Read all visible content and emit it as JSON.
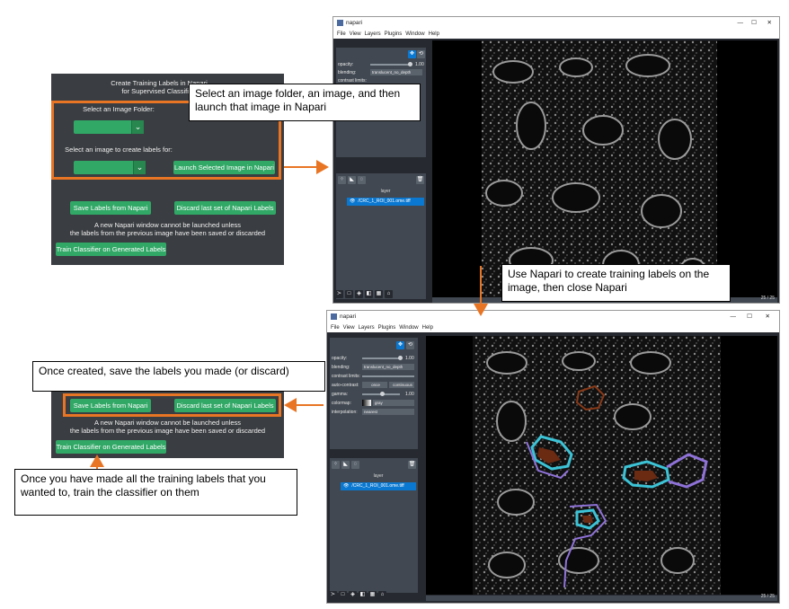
{
  "plugin_top": {
    "title_line1": "Create Training Labels in Napari",
    "title_line2": "for Supervised Classifier:",
    "select_folder_label": "Select an Image Folder:",
    "select_image_label": "Select an image to create labels for:",
    "launch_button": "Launch Selected Image in Napari",
    "save_button": "Save Labels from Napari",
    "discard_button": "Discard last set of Napari Labels",
    "notice_line1": "A new Napari window cannot be launched unless",
    "notice_line2": "the labels from the previous image have been saved or discarded",
    "train_button": "Train Classifier on Generated Labels"
  },
  "plugin_bottom": {
    "save_button": "Save Labels from Napari",
    "discard_button": "Discard last set of Napari Labels",
    "notice_line1": "A new Napari window cannot be launched unless",
    "notice_line2": "the labels from the previous image have been saved or discarded",
    "train_button": "Train Classifier on Generated Labels"
  },
  "callouts": {
    "launch": "Select an image folder, an image, and then launch that image in Napari",
    "use_napari": "Use Napari to create training labels on the image, then close Napari",
    "save": "Once created, save the labels you made (or discard)",
    "train": "Once you have made all the training labels that you wanted to, train the classifier  on them"
  },
  "napari_top": {
    "title": "napari",
    "menu": [
      "File",
      "View",
      "Layers",
      "Plugins",
      "Window",
      "Help"
    ],
    "controls": {
      "opacity_label": "opacity:",
      "opacity_value": "1.00",
      "blending_label": "blending:",
      "blending_value": "translucent_no_depth",
      "contrast_label": "contrast limits:"
    },
    "layer_header": "layer",
    "layer_name": "/CRC_1_ROI_001.ome.tiff",
    "status_right": "25 / 25"
  },
  "napari_bottom": {
    "title": "napari",
    "menu": [
      "File",
      "View",
      "Layers",
      "Plugins",
      "Window",
      "Help"
    ],
    "controls": {
      "opacity_label": "opacity:",
      "opacity_value": "1.00",
      "blending_label": "blending:",
      "blending_value": "translucent_no_depth",
      "contrast_label": "contrast limits:",
      "auto_contrast_label": "auto-contrast:",
      "auto_once": "once",
      "auto_continuous": "continuous",
      "gamma_label": "gamma:",
      "gamma_value": "1.00",
      "colormap_label": "colormap:",
      "colormap_value": "gray",
      "interpolation_label": "interpolation:",
      "interpolation_value": "nearest"
    },
    "layer_header": "layer",
    "layer_name": "/CRC_1_ROI_001.ome.tiff",
    "status_right": "25 / 25"
  },
  "colors": {
    "accent_orange": "#e87524",
    "button_green": "#31a866",
    "panel_bg": "#3a3d41",
    "napari_bg": "#262930",
    "layer_selected": "#0a78d0",
    "label_cyan": "#3cc3d6",
    "label_purple": "#8f72d8",
    "label_brown": "#6b2a12"
  },
  "icons": [
    "chevron-down-icon",
    "arrow-right-icon",
    "arrow-down-icon",
    "eye-icon",
    "trash-icon",
    "terminal-icon",
    "home-icon",
    "grid-icon",
    "move-icon",
    "minimize-icon",
    "maximize-icon",
    "close-icon"
  ]
}
